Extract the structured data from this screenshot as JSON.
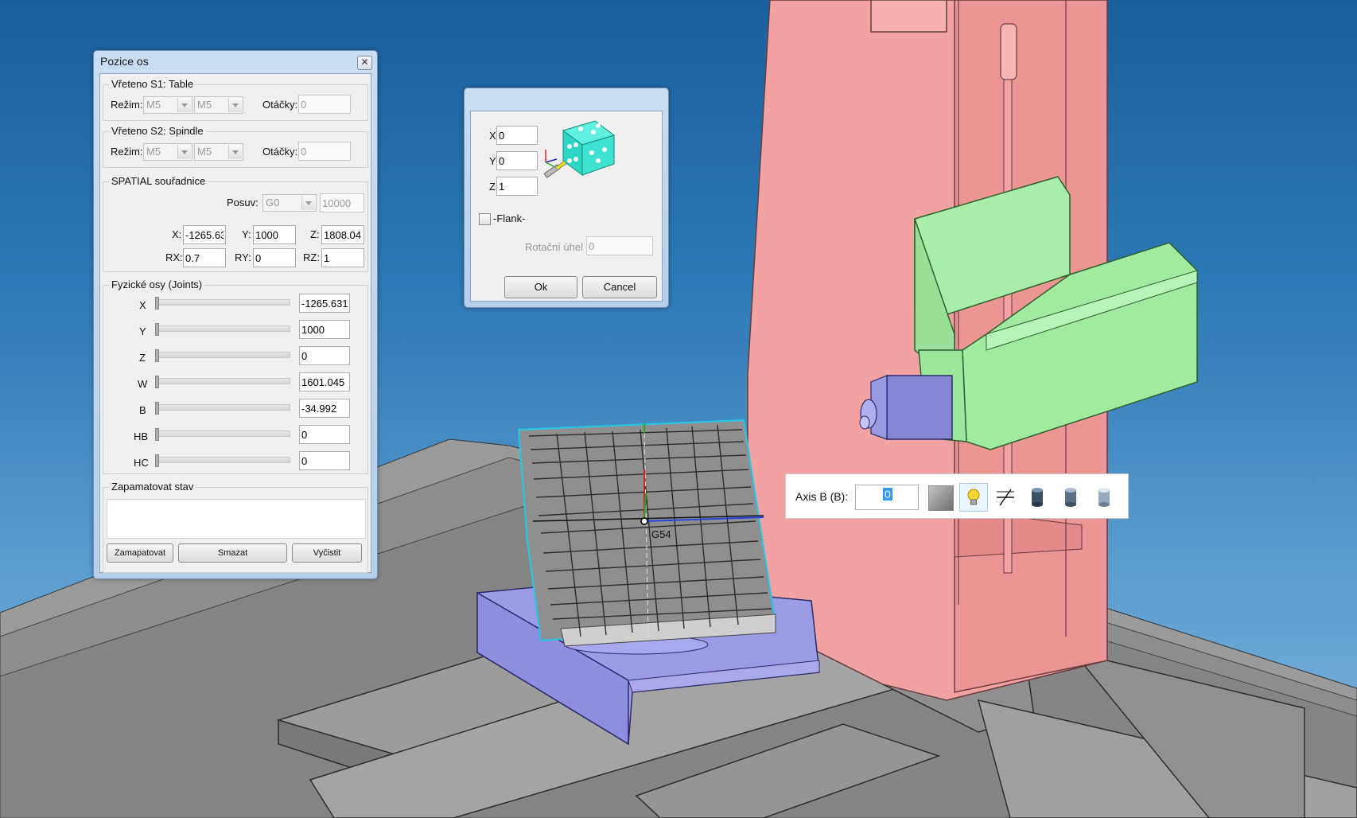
{
  "pozice_os": {
    "title": "Pozice os",
    "close_glyph": "✕",
    "spindle_s1": {
      "title": "Vřeteno S1: Table",
      "mode_label": "Režim:",
      "mode_value_1": "M5",
      "mode_value_2": "M5",
      "rpm_label": "Otáčky:",
      "rpm_value": "0"
    },
    "spindle_s2": {
      "title": "Vřeteno S2: Spindle",
      "mode_label": "Režim:",
      "mode_value_1": "M5",
      "mode_value_2": "M5",
      "rpm_label": "Otáčky:",
      "rpm_value": "0"
    },
    "spatial": {
      "title": "SPATIAL souřadnice",
      "feed_label": "Posuv:",
      "feed_mode": "G0",
      "feed_value": "10000",
      "x_label": "X:",
      "x_value": "-1265.63",
      "y_label": "Y:",
      "y_value": "1000",
      "z_label": "Z:",
      "z_value": "1808.04",
      "rx_label": "RX:",
      "rx_value": "0.7",
      "ry_label": "RY:",
      "ry_value": "0",
      "rz_label": "RZ:",
      "rz_value": "1"
    },
    "joints": {
      "title": "Fyzické osy (Joints)",
      "rows": [
        {
          "label": "X",
          "value": "-1265.631"
        },
        {
          "label": "Y",
          "value": "1000"
        },
        {
          "label": "Z",
          "value": "0"
        },
        {
          "label": "W",
          "value": "1601.045"
        },
        {
          "label": "B",
          "value": "-34.992"
        },
        {
          "label": "HB",
          "value": "0"
        },
        {
          "label": "HC",
          "value": "0"
        }
      ]
    },
    "memory": {
      "title": "Zapamatovat stav",
      "save_label": "Zamapatovat",
      "delete_label": "Smazat",
      "clear_label": "Vyčistit"
    }
  },
  "orient_dialog": {
    "x_label": "X",
    "x_value": "0",
    "y_label": "Y",
    "y_value": "0",
    "z_label": "Z",
    "z_value": "1",
    "flank_label": "-Flank-",
    "rotation_label": "Rotační úhel",
    "rotation_value": "0",
    "ok_label": "Ok",
    "cancel_label": "Cancel"
  },
  "axis_toolbar": {
    "label": "Axis B (B):",
    "value": "0",
    "icons": [
      "color-swatch-icon",
      "light-bulb-icon",
      "section-plane-icon",
      "cylinder-dark-icon",
      "cylinder-mid-icon",
      "cylinder-light-icon"
    ]
  },
  "viewport": {
    "origin_label": "G54"
  },
  "colors": {
    "background_top": "#1a5f9e",
    "column": "#f2a0a0",
    "spindle_head": "#a8eea8",
    "rotary_table": "#9b9be6",
    "machine_bed": "#8a8a8a",
    "selection": "#22c8ea"
  }
}
